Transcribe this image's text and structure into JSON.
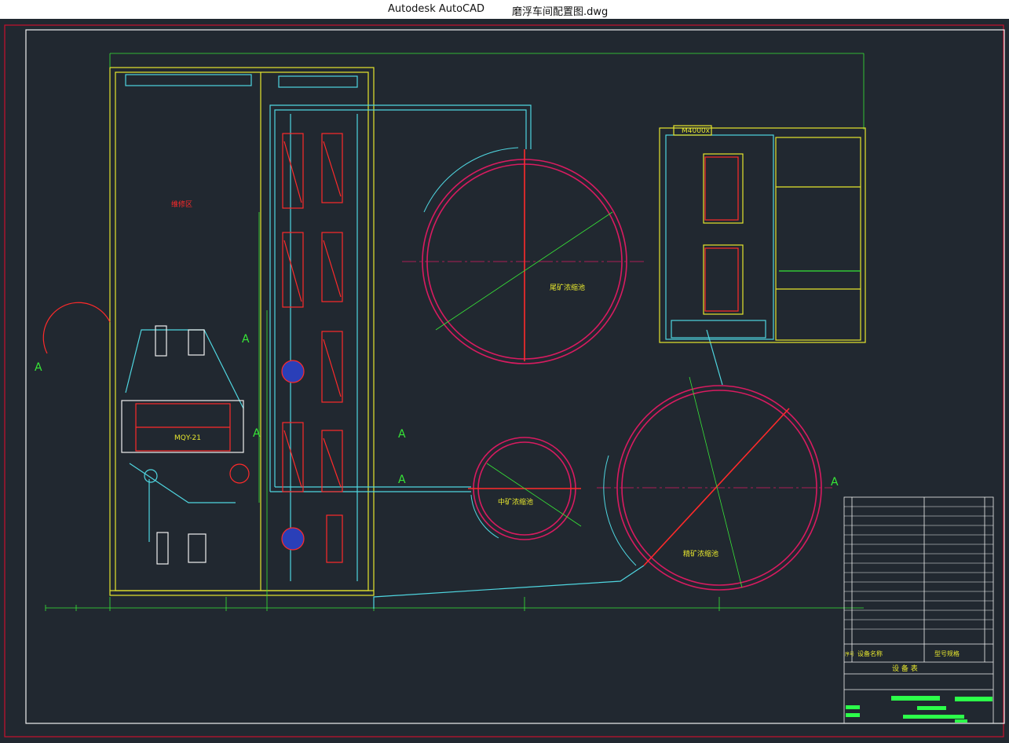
{
  "window": {
    "app_name": "Autodesk AutoCAD",
    "file_name": "磨浮车间配置图.dwg"
  },
  "drawing": {
    "colors": {
      "background": "#212830",
      "frame_red": "#c8102e",
      "frame_white": "#f0f0f0",
      "yellow": "#e6e62e",
      "cyan": "#4fd6e0",
      "magenta": "#d81b60",
      "green": "#37e637",
      "red": "#ff2a2a",
      "lime": "#2cff4a"
    },
    "labels": {
      "repair_area": "维修区",
      "tailings_thickener": "尾矿浓缩池",
      "middlings_thickener": "中矿浓缩池",
      "concentrate_thickener": "精矿浓缩池",
      "ball_mill": "MQY-21",
      "room_dim": "M4000x",
      "section_a": "A"
    },
    "equipment_table": {
      "header_name": "设备名称",
      "header_spec": "型号规格",
      "header_index": "序号",
      "footer": "设 备 表"
    }
  }
}
